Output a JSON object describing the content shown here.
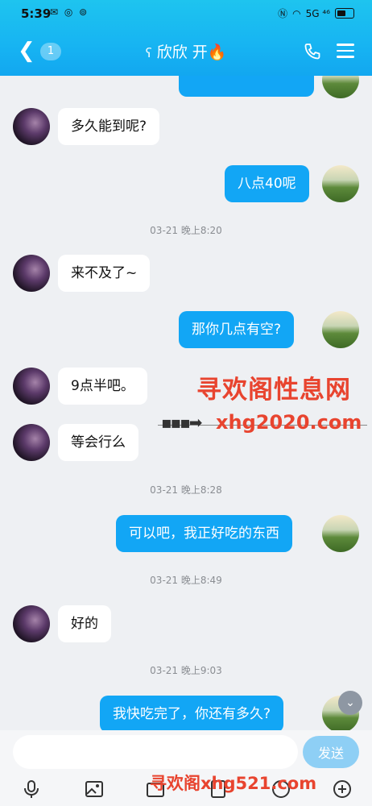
{
  "status_bar": {
    "time": "5:39",
    "network": "5G ⁴⁶"
  },
  "header": {
    "unread_count": "1",
    "contact_name": "欣欣 开🔥"
  },
  "messages": [
    {
      "side": "left",
      "text": "多久能到呢?"
    },
    {
      "side": "right",
      "text": "八点40呢"
    },
    {
      "timestamp": "03-21 晚上8:20"
    },
    {
      "side": "left",
      "text": "来不及了~"
    },
    {
      "side": "right",
      "text": "那你几点有空?"
    },
    {
      "side": "left",
      "text": "9点半吧。"
    },
    {
      "side": "left",
      "text": "等会行么"
    },
    {
      "timestamp": "03-21 晚上8:28"
    },
    {
      "side": "right",
      "text": "可以吧，我正好吃的东西"
    },
    {
      "timestamp": "03-21 晚上8:49"
    },
    {
      "side": "left",
      "text": "好的"
    },
    {
      "timestamp": "03-21 晚上9:03"
    },
    {
      "side": "right",
      "text": "我快吃完了，你还有多久?"
    }
  ],
  "watermark": {
    "title": "寻欢阁性息网",
    "url": "xhg2020.com",
    "bottom": "寻欢阁xhg521.com"
  },
  "input": {
    "placeholder": "",
    "send_label": "发送"
  },
  "colors": {
    "header": "#17b4f2",
    "bubble_right": "#12a6f5",
    "watermark": "#e8442f"
  }
}
